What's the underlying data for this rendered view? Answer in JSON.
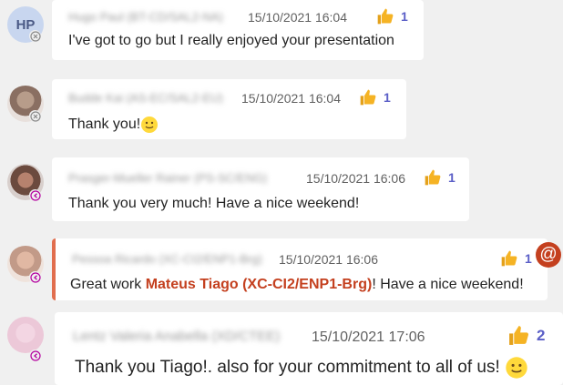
{
  "messages": [
    {
      "avatar_initials": "HP",
      "sender": "Hugo Paul (BT-CD/SAL2-NA)",
      "time": "15/10/2021 16:04",
      "text": "I've got to go but I really enjoyed your presentation",
      "reaction_count": "1"
    },
    {
      "sender": "Budde Kai (AS-EC/SAL2-EU)",
      "time": "15/10/2021 16:04",
      "text": "Thank you!",
      "reaction_count": "1"
    },
    {
      "sender": "Prasger-Mueller Rainer (PS-SC/ENG)",
      "time": "15/10/2021 16:06",
      "text": "Thank you very much! Have a nice weekend!",
      "reaction_count": "1"
    },
    {
      "sender": "Pessoa Ricardo (XC-CI2/ENP1-Brg)",
      "time": "15/10/2021 16:06",
      "text_before": "Great work ",
      "mention": "Mateus Tiago (XC-CI2/ENP1-Brg)",
      "text_after": "! Have a nice weekend!",
      "reaction_count": "1",
      "mention_badge": "@"
    },
    {
      "sender": "Lentz Valeria Anabella (XD/CTEE)",
      "time": "15/10/2021 17:06",
      "text": "Thank you Tiago!. also for your commitment to all of us!",
      "reaction_count": "2"
    }
  ],
  "icons": {
    "reaction": "thumbs-up-icon",
    "status_offline": "offline-x-icon",
    "status_away": "away-arrow-icon",
    "emoji_smile": "smile-emoji-icon"
  },
  "colors": {
    "accent": "#5b5fc7",
    "mention": "#c4401f",
    "away": "#b4009e",
    "thumb": "#f5b324"
  }
}
